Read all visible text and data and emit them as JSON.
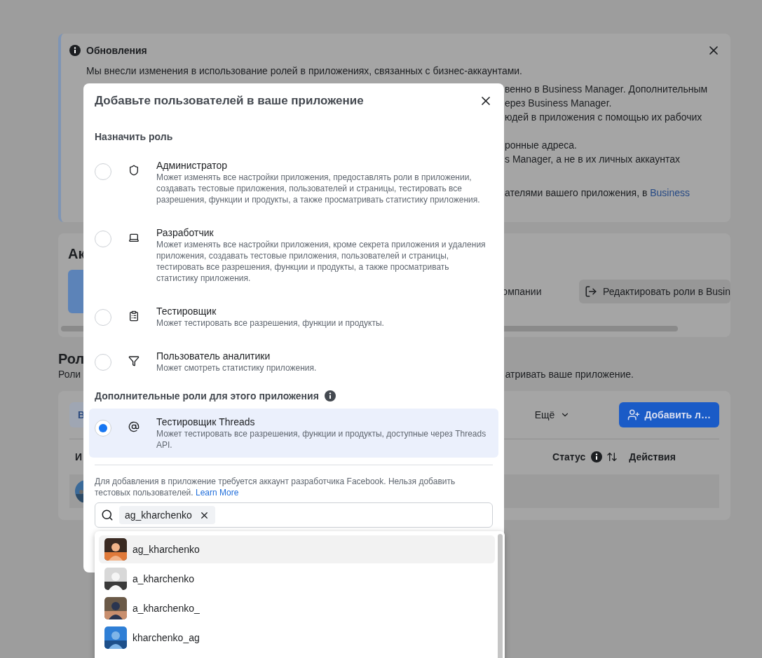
{
  "updates_card": {
    "title": "Обновления",
    "first_line": "Мы внесли изменения в использование ролей в приложениях, связанных с бизнес-аккаунтами.",
    "fragments": [
      {
        "text": "венно в Business Manager. Дополнительным"
      },
      {
        "text": "ерез Business Manager."
      },
      {
        "text": "юдей в приложения с помощью их рабочих"
      },
      {
        "text": "ронные адреса."
      },
      {
        "text": "s Manager, а не в их личных аккаунтах"
      },
      {
        "text": "ателями вашего приложения, в ",
        "link": "Business"
      }
    ]
  },
  "apps_card": {
    "heading": "Ак",
    "fragment": "омпании",
    "edit_button": "Редактировать роли в Busin"
  },
  "roles_section": {
    "heading": "Рол",
    "subtitle_start": "Роли",
    "subtitle_end": "атривать ваше приложение."
  },
  "users_card": {
    "tab": "В",
    "more": "Ещё",
    "add_button": "Добавить л…",
    "columns": [
      "И",
      "Статус",
      "Действия"
    ]
  },
  "modal": {
    "title": "Добавьте пользователей в ваше приложение",
    "section_title": "Назначить роль",
    "roles": [
      {
        "kind": "shield",
        "title": "Администратор",
        "description": "Может изменять все настройки приложения, предоставлять роли в приложении, создавать тестовые приложения, пользователей и страницы, тестировать все разрешения, функции и продукты, а также просматривать статистику приложения.",
        "selected": false
      },
      {
        "kind": "laptop",
        "title": "Разработчик",
        "description": "Может изменять все настройки приложения, кроме секрета приложения и удаления приложения, создавать тестовые приложения, пользователей и страницы, тестировать все разрешения, функции и продукты, а также просматривать статистику приложения.",
        "selected": false
      },
      {
        "kind": "clipboard",
        "title": "Тестировщик",
        "description": "Может тестировать все разрешения, функции и продукты.",
        "selected": false
      },
      {
        "kind": "filter",
        "title": "Пользователь аналитики",
        "description": "Может смотреть статистику приложения.",
        "selected": false
      }
    ],
    "extra_title": "Дополнительные роли для этого приложения",
    "extra_roles": [
      {
        "kind": "threads",
        "title": "Тестировщик Threads",
        "description": "Может тестировать все разрешения, функции и продукты, доступные через Threads API.",
        "selected": true
      }
    ],
    "note": "Для добавления в приложение требуется аккаунт разработчика Facebook. Нельзя добавить тестовых пользователей.",
    "note_link": "Learn More",
    "chip": "ag_kharchenko",
    "suggestions": [
      {
        "name": "ag_kharchenko",
        "highlighted": true,
        "kind": "picture"
      },
      {
        "name": "a_kharchenko",
        "highlighted": false,
        "kind": "picture"
      },
      {
        "name": "a_kharchenko_",
        "highlighted": false,
        "kind": "picture"
      },
      {
        "name": "kharchenko_ag",
        "highlighted": false,
        "kind": "picture"
      }
    ]
  }
}
